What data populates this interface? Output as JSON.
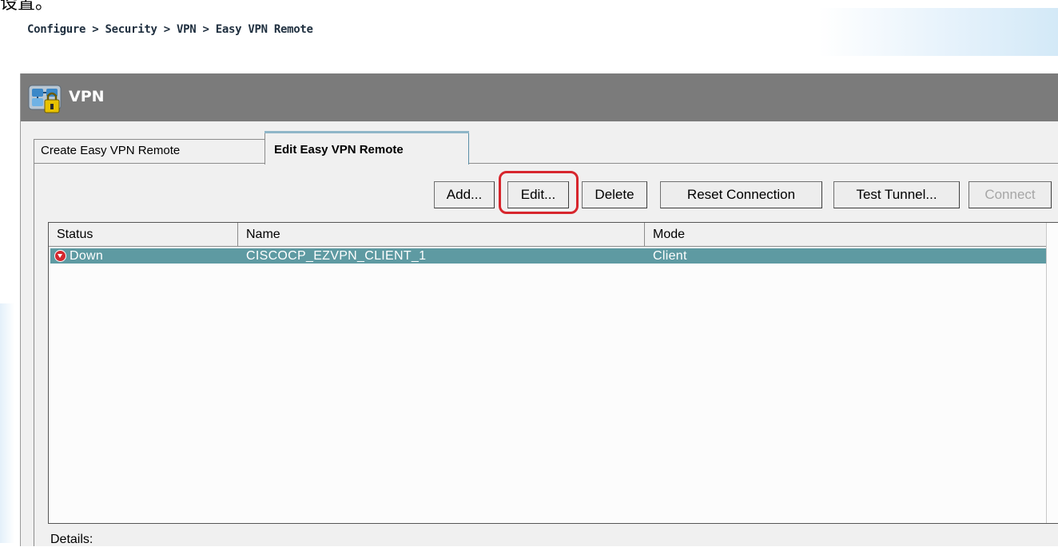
{
  "breadcrumb": "Configure > Security > VPN > Easy VPN Remote",
  "top_clip_text": "设置。",
  "header": {
    "title": "VPN",
    "icon": "vpn-network-lock-icon"
  },
  "tabs": [
    {
      "label": "Create Easy VPN Remote",
      "active": false
    },
    {
      "label": "Edit Easy VPN Remote",
      "active": true
    }
  ],
  "toolbar": {
    "add": "Add...",
    "edit": "Edit...",
    "delete": "Delete",
    "reset": "Reset Connection",
    "test": "Test Tunnel...",
    "connect": "Connect"
  },
  "table": {
    "columns": [
      "Status",
      "Name",
      "Mode"
    ],
    "rows": [
      {
        "status": "Down",
        "name": "CISCOCP_EZVPN_CLIENT_1",
        "mode": "Client"
      }
    ]
  },
  "details_label": "Details:",
  "colors": {
    "header_bg": "#7b7b7b",
    "selected_row": "#5e9aa2",
    "highlight": "#d7262d",
    "status_down": "#d3282e"
  }
}
